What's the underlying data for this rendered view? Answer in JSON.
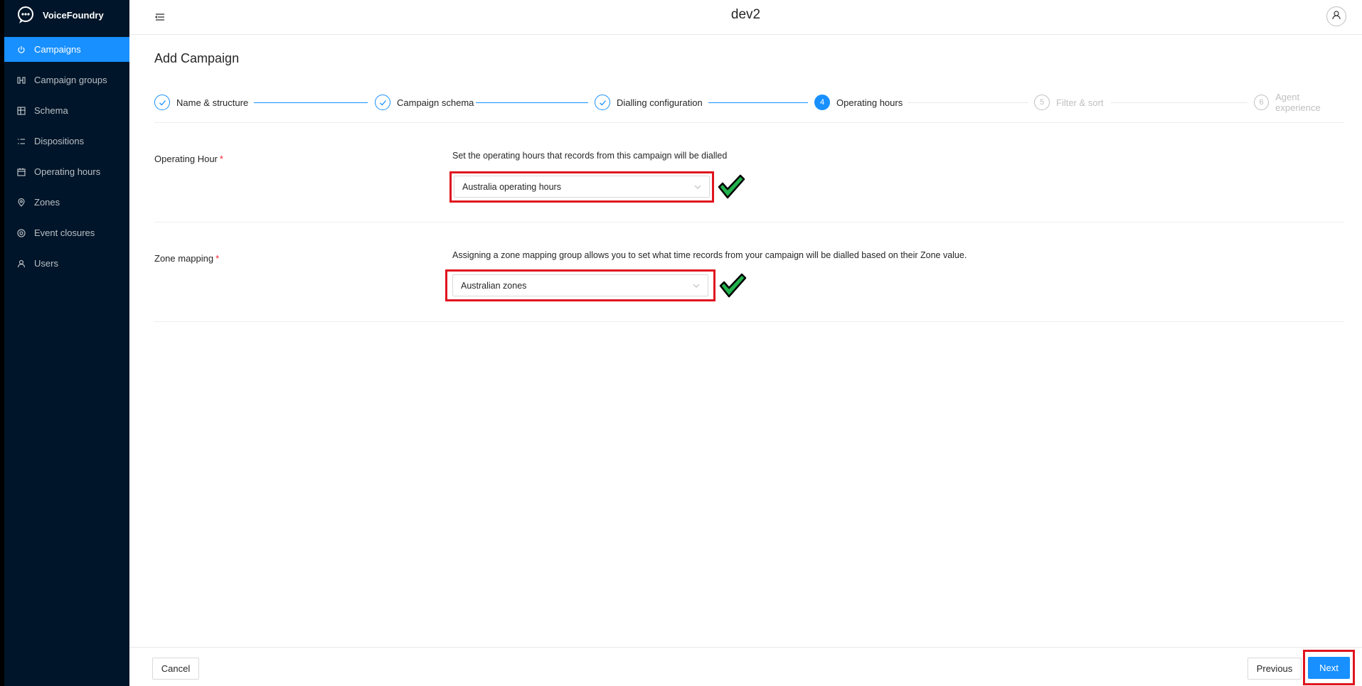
{
  "app": {
    "brand": "VoiceFoundry",
    "env_title": "dev2"
  },
  "sidebar": {
    "items": [
      {
        "label": "Campaigns",
        "icon": "power-icon",
        "active": true
      },
      {
        "label": "Campaign groups",
        "icon": "campaign-groups-icon",
        "active": false
      },
      {
        "label": "Schema",
        "icon": "schema-icon",
        "active": false
      },
      {
        "label": "Dispositions",
        "icon": "list-icon",
        "active": false
      },
      {
        "label": "Operating hours",
        "icon": "calendar-icon",
        "active": false
      },
      {
        "label": "Zones",
        "icon": "location-pin-icon",
        "active": false
      },
      {
        "label": "Event closures",
        "icon": "target-icon",
        "active": false
      },
      {
        "label": "Users",
        "icon": "user-icon",
        "active": false
      }
    ]
  },
  "page": {
    "title": "Add Campaign"
  },
  "steps": [
    {
      "number": "1",
      "label": "Name & structure",
      "status": "done"
    },
    {
      "number": "2",
      "label": "Campaign schema",
      "status": "done"
    },
    {
      "number": "3",
      "label": "Dialling configuration",
      "status": "done"
    },
    {
      "number": "4",
      "label": "Operating hours",
      "status": "current"
    },
    {
      "number": "5",
      "label": "Filter & sort",
      "status": "pending"
    },
    {
      "number": "6",
      "label": "Agent experience",
      "status": "pending"
    }
  ],
  "form": {
    "operating_hour": {
      "label": "Operating Hour",
      "required_mark": "*",
      "help": "Set the operating hours that records from this campaign will be dialled",
      "value": "Australia operating hours"
    },
    "zone_mapping": {
      "label": "Zone mapping",
      "required_mark": "*",
      "help": "Assigning a zone mapping group allows you to set what time records from your campaign will be dialled based on their Zone value.",
      "value": "Australian zones"
    }
  },
  "footer": {
    "cancel_label": "Cancel",
    "previous_label": "Previous",
    "next_label": "Next"
  },
  "colors": {
    "sidebar_bg": "#001529",
    "accent": "#1890ff",
    "highlight": "#e0141e",
    "check_green": "#22b14c"
  }
}
